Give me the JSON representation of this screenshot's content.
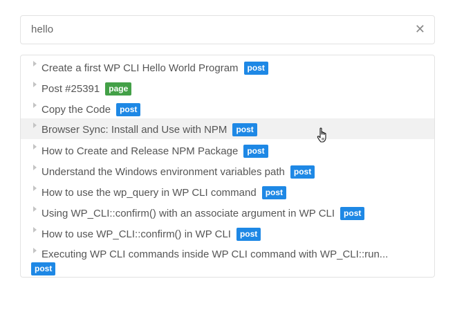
{
  "search": {
    "query": "hello",
    "clear_icon": "close-icon"
  },
  "results": [
    {
      "title": "Create a first WP CLI Hello World Program",
      "type": "post"
    },
    {
      "title": "Post #25391",
      "type": "page"
    },
    {
      "title": "Copy the Code",
      "type": "post"
    },
    {
      "title": "Browser Sync: Install and Use with NPM",
      "type": "post"
    },
    {
      "title": "How to Create and Release NPM Package",
      "type": "post"
    },
    {
      "title": "Understand the Windows environment variables path",
      "type": "post"
    },
    {
      "title": "How to use the wp_query in WP CLI command",
      "type": "post"
    },
    {
      "title": "Using WP_CLI::confirm() with an associate argument in WP CLI",
      "type": "post"
    },
    {
      "title": "How to use WP_CLI::confirm() in WP CLI",
      "type": "post"
    },
    {
      "title": "Executing WP CLI commands inside WP CLI command with WP_CLI::run...",
      "type": "post"
    }
  ],
  "colors": {
    "post_badge": "#1e88e5",
    "page_badge": "#43a047",
    "hover_row": "#f1f1f1"
  }
}
